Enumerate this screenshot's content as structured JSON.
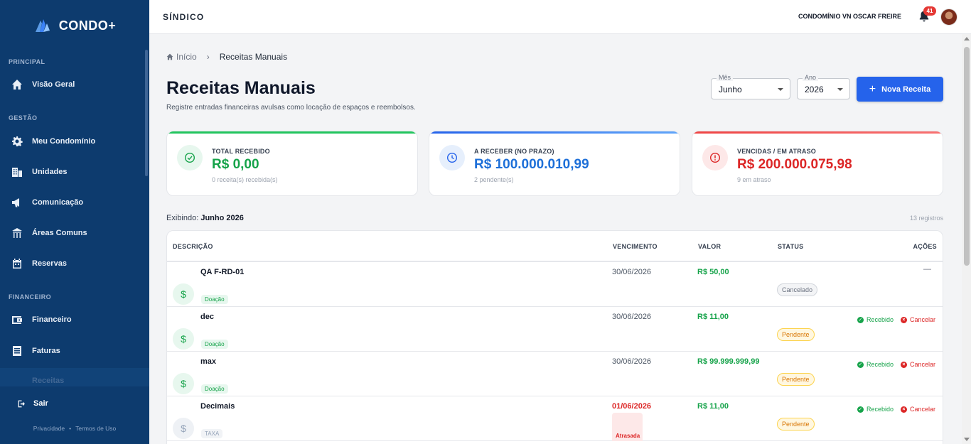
{
  "sidebar": {
    "brand": "CONDO+",
    "sections": [
      {
        "title": "PRINCIPAL"
      },
      {
        "title": "GESTÃO"
      },
      {
        "title": "FINANCEIRO"
      }
    ],
    "items": [
      {
        "label": "Visão Geral",
        "icon": "home-icon"
      },
      {
        "label": "Meu Condomínio",
        "icon": "gear-icon"
      },
      {
        "label": "Unidades",
        "icon": "building-icon"
      },
      {
        "label": "Comunicação",
        "icon": "megaphone-icon"
      },
      {
        "label": "Áreas Comuns",
        "icon": "pavilion-icon"
      },
      {
        "label": "Reservas",
        "icon": "calendar-icon"
      },
      {
        "label": "Financeiro",
        "icon": "wallet-icon"
      },
      {
        "label": "Faturas",
        "icon": "document-icon"
      },
      {
        "label": "Receitas",
        "icon": "receipt-icon"
      }
    ],
    "logout": "Sair",
    "footer": {
      "privacy": "Privacidade",
      "terms": "Termos de Uso"
    }
  },
  "topbar": {
    "role": "SÍNDICO",
    "condo": "CONDOMÍNIO VN OSCAR FREIRE",
    "notifications": "41"
  },
  "breadcrumb": {
    "home": "Início",
    "current": "Receitas Manuais"
  },
  "page": {
    "title": "Receitas Manuais",
    "subtitle": "Registre entradas financeiras avulsas como locação de espaços e reembolsos."
  },
  "filters": {
    "month": {
      "label": "Mês",
      "value": "Junho"
    },
    "year": {
      "label": "Ano",
      "value": "2026"
    },
    "new_button": "Nova Receita"
  },
  "cards": [
    {
      "title": "TOTAL RECEBIDO",
      "value": "R$ 0,00",
      "sub": "0 receita(s) recebida(s)",
      "color": "#16a34a",
      "bar": "#22c55e"
    },
    {
      "title": "A RECEBER (NO PRAZO)",
      "value": "R$ 100.000.010,99",
      "sub": "2 pendente(s)",
      "color": "#1d6fd8",
      "bar": "#2563eb"
    },
    {
      "title": "VENCIDAS / EM ATRASO",
      "value": "R$ 200.000.075,98",
      "sub": "9 em atraso",
      "color": "#dc2626",
      "bar": "#ef4444"
    }
  ],
  "listing": {
    "label": "Exibindo:",
    "period": "Junho 2026",
    "count": "13 registros"
  },
  "table": {
    "headers": {
      "desc": "DESCRIÇÃO",
      "venc": "VENCIMENTO",
      "valor": "VALOR",
      "status": "STATUS",
      "acoes": "AÇÕES"
    },
    "rows": [
      {
        "name": "QA F-RD-01",
        "tag": "Doação",
        "venc": "30/06/2026",
        "valor": "R$ 50,00",
        "status": "Cancelado",
        "acts": "—"
      },
      {
        "name": "dec",
        "tag": "Doação",
        "venc": "30/06/2026",
        "valor": "R$ 11,00",
        "status": "Pendente",
        "ok": "Recebido",
        "no": "Cancelar"
      },
      {
        "name": "max",
        "tag": "Doação",
        "venc": "30/06/2026",
        "valor": "R$ 99.999.999,99",
        "status": "Pendente",
        "ok": "Recebido",
        "no": "Cancelar"
      },
      {
        "name": "Decimais",
        "tag": "TAXA",
        "venc": "01/06/2026",
        "late": "Atrasada",
        "valor": "R$ 11,00",
        "status": "Pendente",
        "ok": "Recebido",
        "no": "Cancelar"
      }
    ]
  }
}
